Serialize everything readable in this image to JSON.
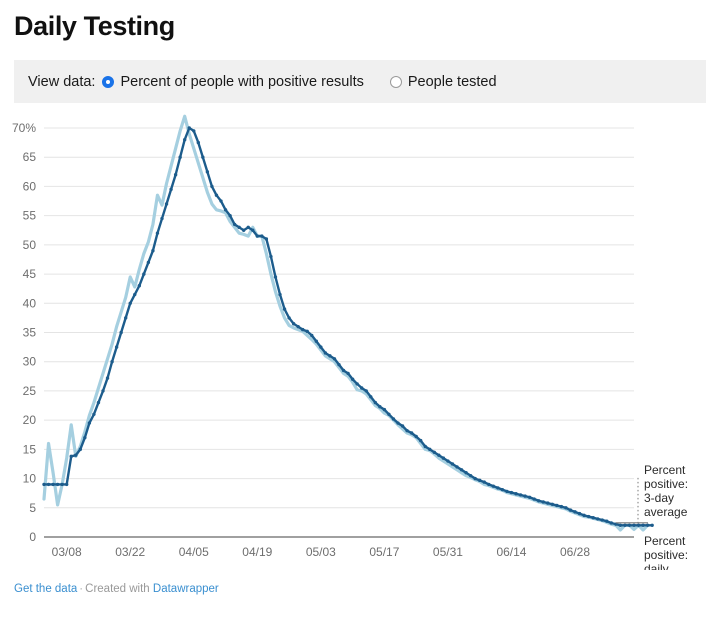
{
  "header": {
    "title": "Daily Testing"
  },
  "controls": {
    "label": "View data:",
    "options": [
      {
        "label": "Percent of people with positive results",
        "selected": true
      },
      {
        "label": "People tested",
        "selected": false
      }
    ]
  },
  "footer": {
    "get_data": "Get the data",
    "separator": "·",
    "created_with": "Created with",
    "datawrapper": "Datawrapper"
  },
  "colors": {
    "line_dark": "#1c5c8c",
    "line_light": "#a5cfe0",
    "accent_blue": "#1a73e8",
    "control_bg": "#f0f0f0",
    "grid": "#e4e4e4",
    "axis": "#808080",
    "tick_text": "#6e6e6e",
    "link": "#3a8fd0"
  },
  "chart_data": {
    "type": "line",
    "title": "Daily Testing",
    "xlabel": "",
    "ylabel": "",
    "ylim": [
      0,
      70
    ],
    "yticks": [
      0,
      5,
      10,
      15,
      20,
      25,
      30,
      35,
      40,
      45,
      50,
      55,
      60,
      65,
      70
    ],
    "ytick_labels": [
      "0",
      "5",
      "10",
      "15",
      "20",
      "25",
      "30",
      "35",
      "40",
      "45",
      "50",
      "55",
      "60",
      "65",
      "70%"
    ],
    "grid": true,
    "legend_position": "right-annotations",
    "xtick_labels": [
      "03/08",
      "03/22",
      "04/05",
      "04/19",
      "05/03",
      "05/17",
      "05/31",
      "06/14",
      "06/28"
    ],
    "xtick_indices": [
      5,
      19,
      33,
      47,
      61,
      75,
      89,
      103,
      117
    ],
    "x_count": 131,
    "annotations": [
      {
        "name": "3-day average",
        "text": "Percent positive: 3-day average",
        "lines": [
          "Percent",
          "positive:",
          "3-day",
          "average"
        ],
        "color": "#a5cfe0"
      },
      {
        "name": "daily",
        "text": "Percent positive: daily",
        "lines": [
          "Percent",
          "positive:",
          "daily"
        ],
        "color": "#1c5c8c"
      }
    ],
    "series": [
      {
        "name": "Percent positive: 3-day average",
        "color": "#a5cfe0",
        "values": [
          6.5,
          16.0,
          11.0,
          5.5,
          9.0,
          13.5,
          19.2,
          13.8,
          15.5,
          18.0,
          20.8,
          23.0,
          25.5,
          28.0,
          30.5,
          33.0,
          36.0,
          38.5,
          41.0,
          44.5,
          42.8,
          45.8,
          48.5,
          50.5,
          53.5,
          58.5,
          56.8,
          60.5,
          63.5,
          66.5,
          69.5,
          72.0,
          69.0,
          66.5,
          64.0,
          61.5,
          59.0,
          57.0,
          56.0,
          55.8,
          55.5,
          54.0,
          53.0,
          52.0,
          51.8,
          51.5,
          53.0,
          51.5,
          51.5,
          48.5,
          45.0,
          42.0,
          39.5,
          37.5,
          36.2,
          35.8,
          35.5,
          35.2,
          34.5,
          33.8,
          33.0,
          32.0,
          31.0,
          30.5,
          30.0,
          29.0,
          28.0,
          27.5,
          26.5,
          25.2,
          25.0,
          24.5,
          23.5,
          22.5,
          22.0,
          21.2,
          20.8,
          20.0,
          19.2,
          18.5,
          17.8,
          17.5,
          17.0,
          16.0,
          15.0,
          14.8,
          14.2,
          13.5,
          13.0,
          12.5,
          12.0,
          11.5,
          11.0,
          10.5,
          10.2,
          9.8,
          9.5,
          9.0,
          8.8,
          8.5,
          8.2,
          8.0,
          7.6,
          7.4,
          7.2,
          7.0,
          6.8,
          6.6,
          6.3,
          6.0,
          5.8,
          5.6,
          5.4,
          5.2,
          5.0,
          4.8,
          4.4,
          4.1,
          3.8,
          3.5,
          3.4,
          3.2,
          3.0,
          2.8,
          2.5,
          2.2,
          2.0,
          1.2,
          2.0,
          2.0,
          1.3,
          2.0,
          1.2,
          2.0
        ],
        "marker": false
      },
      {
        "name": "Percent positive: daily",
        "color": "#1c5c8c",
        "values": [
          9.0,
          9.0,
          9.0,
          9.0,
          9.0,
          9.0,
          13.8,
          14.0,
          15.0,
          17.0,
          19.5,
          21.0,
          23.0,
          25.0,
          27.2,
          30.0,
          32.5,
          35.0,
          37.5,
          40.0,
          41.5,
          43.0,
          45.0,
          47.0,
          49.0,
          52.0,
          54.5,
          57.0,
          59.5,
          62.0,
          65.0,
          68.0,
          70.0,
          69.5,
          67.5,
          65.0,
          62.5,
          60.0,
          58.5,
          57.5,
          56.0,
          55.0,
          53.5,
          53.0,
          52.5,
          53.0,
          52.5,
          51.5,
          51.5,
          51.0,
          48.0,
          44.5,
          41.5,
          39.0,
          37.5,
          36.5,
          36.0,
          35.5,
          35.2,
          34.5,
          33.5,
          32.5,
          31.5,
          31.0,
          30.5,
          29.5,
          28.5,
          28.0,
          27.0,
          26.2,
          25.5,
          25.0,
          24.0,
          23.0,
          22.3,
          21.8,
          21.0,
          20.2,
          19.5,
          19.0,
          18.2,
          17.8,
          17.2,
          16.5,
          15.5,
          15.0,
          14.5,
          14.0,
          13.5,
          13.0,
          12.5,
          12.0,
          11.5,
          11.0,
          10.5,
          10.0,
          9.7,
          9.4,
          9.0,
          8.7,
          8.4,
          8.1,
          7.8,
          7.6,
          7.4,
          7.2,
          7.0,
          6.8,
          6.5,
          6.2,
          6.0,
          5.8,
          5.6,
          5.4,
          5.2,
          5.0,
          4.6,
          4.3,
          4.0,
          3.7,
          3.5,
          3.3,
          3.1,
          2.9,
          2.7,
          2.4,
          2.2,
          2.0,
          2.0,
          2.0,
          2.0,
          2.0,
          2.0,
          2.0,
          2.0
        ],
        "marker": true
      }
    ]
  }
}
